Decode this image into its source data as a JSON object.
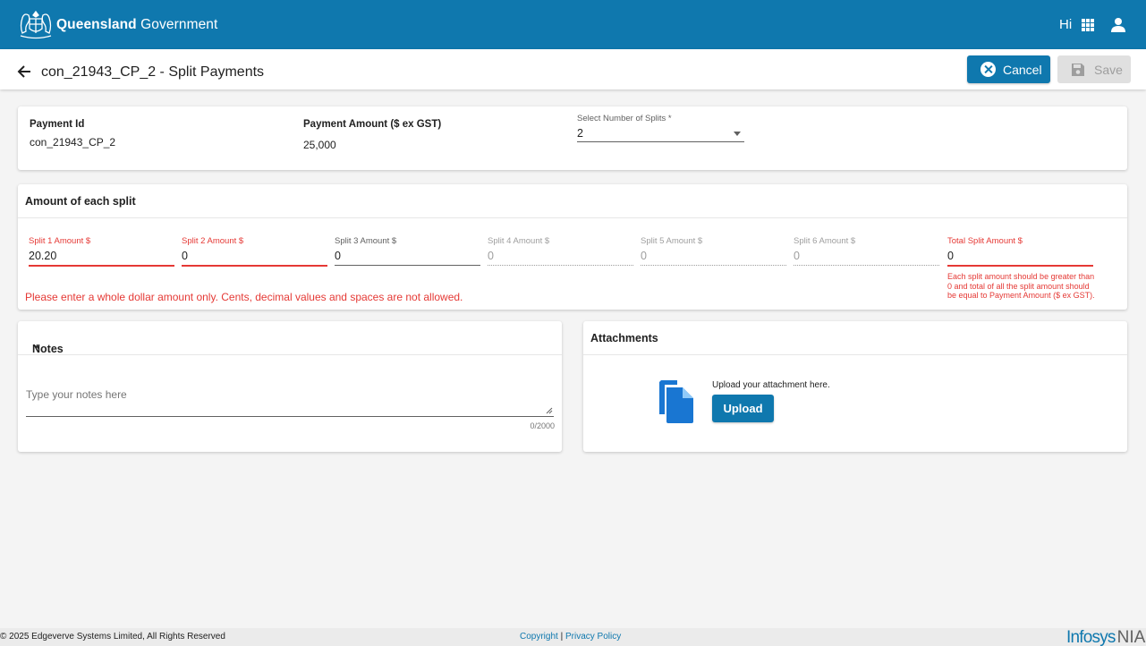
{
  "header": {
    "brand_bold": "Queensland",
    "brand_light": "Government",
    "greeting": "Hi"
  },
  "titlebar": {
    "title": "con_21943_CP_2 - Split Payments",
    "cancel_label": "Cancel",
    "save_label": "Save"
  },
  "summary": {
    "payment_id_label": "Payment Id",
    "payment_id": "con_21943_CP_2",
    "amount_label": "Payment Amount ($ ex GST)",
    "amount": "25,000",
    "splits_label": "Select Number of Splits *",
    "splits_value": "2"
  },
  "splits": {
    "heading": "Amount of each split",
    "fields": [
      {
        "label": "Split 1 Amount $",
        "value": "20.20",
        "state": "error"
      },
      {
        "label": "Split 2 Amount $",
        "value": "0",
        "state": "error"
      },
      {
        "label": "Split 3 Amount $",
        "value": "0",
        "state": "normal"
      },
      {
        "label": "Split 4 Amount $",
        "value": "0",
        "state": "disabled"
      },
      {
        "label": "Split 5 Amount $",
        "value": "0",
        "state": "disabled"
      },
      {
        "label": "Split 6 Amount $",
        "value": "0",
        "state": "disabled"
      },
      {
        "label": "Total Split Amount $",
        "value": "0",
        "state": "error"
      }
    ],
    "error_message": "Please enter a whole dollar amount only. Cents, decimal values and spaces are not allowed.",
    "total_hint": "Each split amount should be greater than 0 and total of all the split amount should be equal to Payment Amount ($ ex GST)."
  },
  "notes": {
    "heading": "Notes",
    "required_mark": "*",
    "placeholder": "Type your notes here",
    "counter": "0/2000"
  },
  "attachments": {
    "heading": "Attachments",
    "hint": "Upload your attachment here.",
    "upload_label": "Upload"
  },
  "footer": {
    "copyright": "© 2025 Edgeverve Systems Limited, All Rights Reserved",
    "copyright_link": "Copyright",
    "separator": "|",
    "privacy_link": "Privacy Policy",
    "logo_main": "Infosys",
    "logo_suffix": "NIA"
  },
  "colors": {
    "primary": "#0f78ae",
    "error": "#e53935"
  }
}
